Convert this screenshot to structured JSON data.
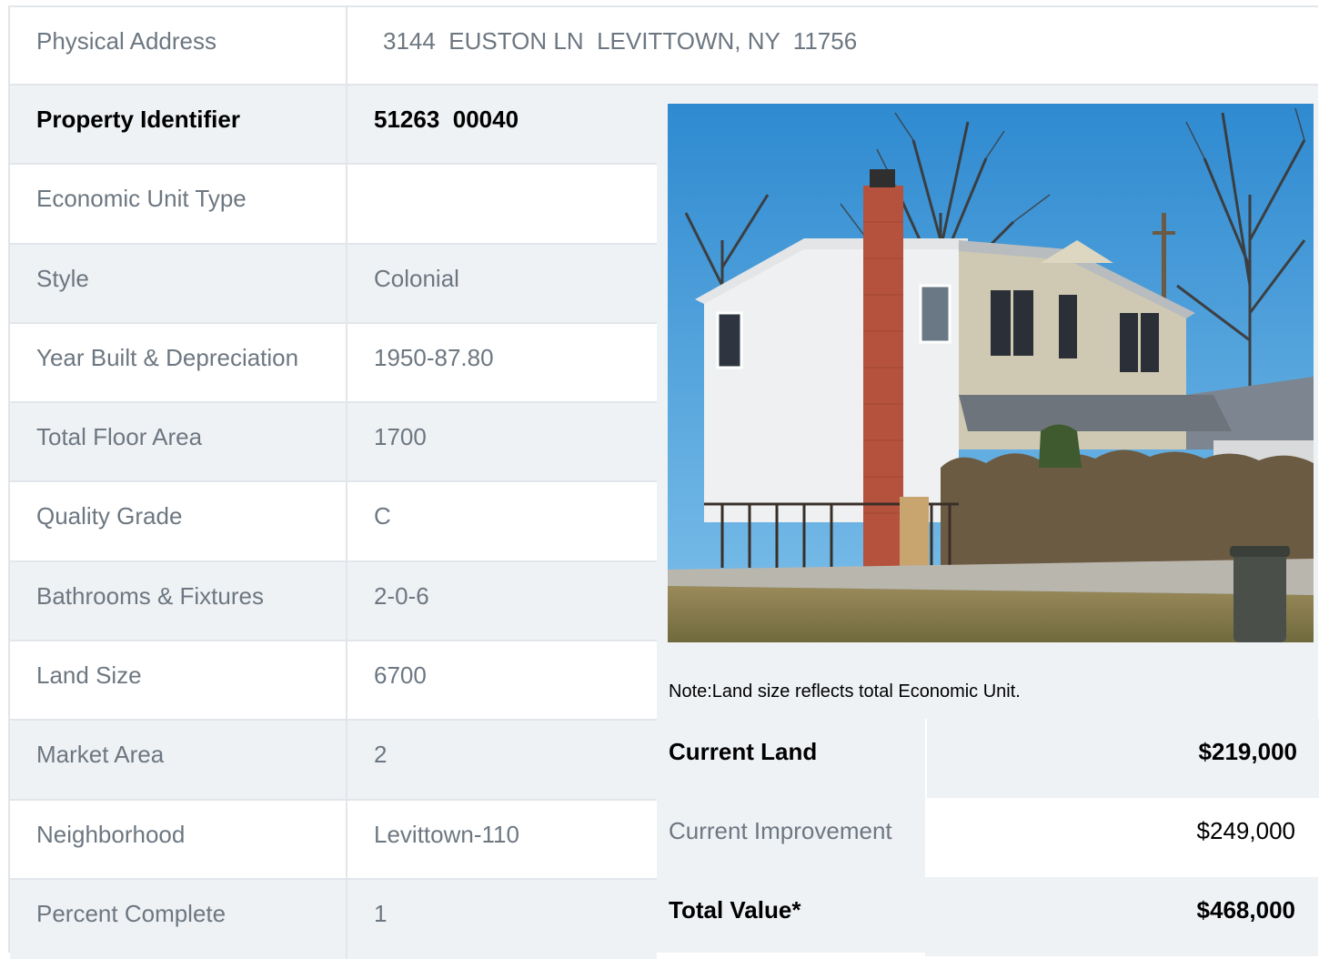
{
  "address": {
    "label": "Physical Address",
    "value": "3144  EUSTON LN  LEVITTOWN, NY  11756"
  },
  "details": [
    {
      "label": "Property Identifier",
      "value": "51263  00040",
      "bold": true
    },
    {
      "label": "Economic Unit Type",
      "value": ""
    },
    {
      "label": "Style",
      "value": "Colonial"
    },
    {
      "label": "Year Built & Depreciation",
      "value": "1950-87.80"
    },
    {
      "label": "Total Floor Area",
      "value": "1700"
    },
    {
      "label": "Quality Grade",
      "value": "C"
    },
    {
      "label": "Bathrooms & Fixtures",
      "value": "2-0-6"
    },
    {
      "label": "Land Size",
      "value": "6700"
    },
    {
      "label": "Market Area",
      "value": "2"
    },
    {
      "label": "Neighborhood",
      "value": "Levittown-110"
    },
    {
      "label": "Percent Complete",
      "value": "1"
    }
  ],
  "note": "Note:Land size reflects total Economic Unit.",
  "values": [
    {
      "label": "Current Land",
      "amount": "$219,000",
      "bold": true
    },
    {
      "label": "Current Improvement",
      "amount": "$249,000"
    },
    {
      "label": "Total Value*",
      "amount": "$468,000",
      "bold": true
    }
  ],
  "colors": {
    "row_shade": "#eff2f5",
    "border": "#e2e6ea",
    "label_text": "#6d7781",
    "bold_text": "#000000"
  }
}
